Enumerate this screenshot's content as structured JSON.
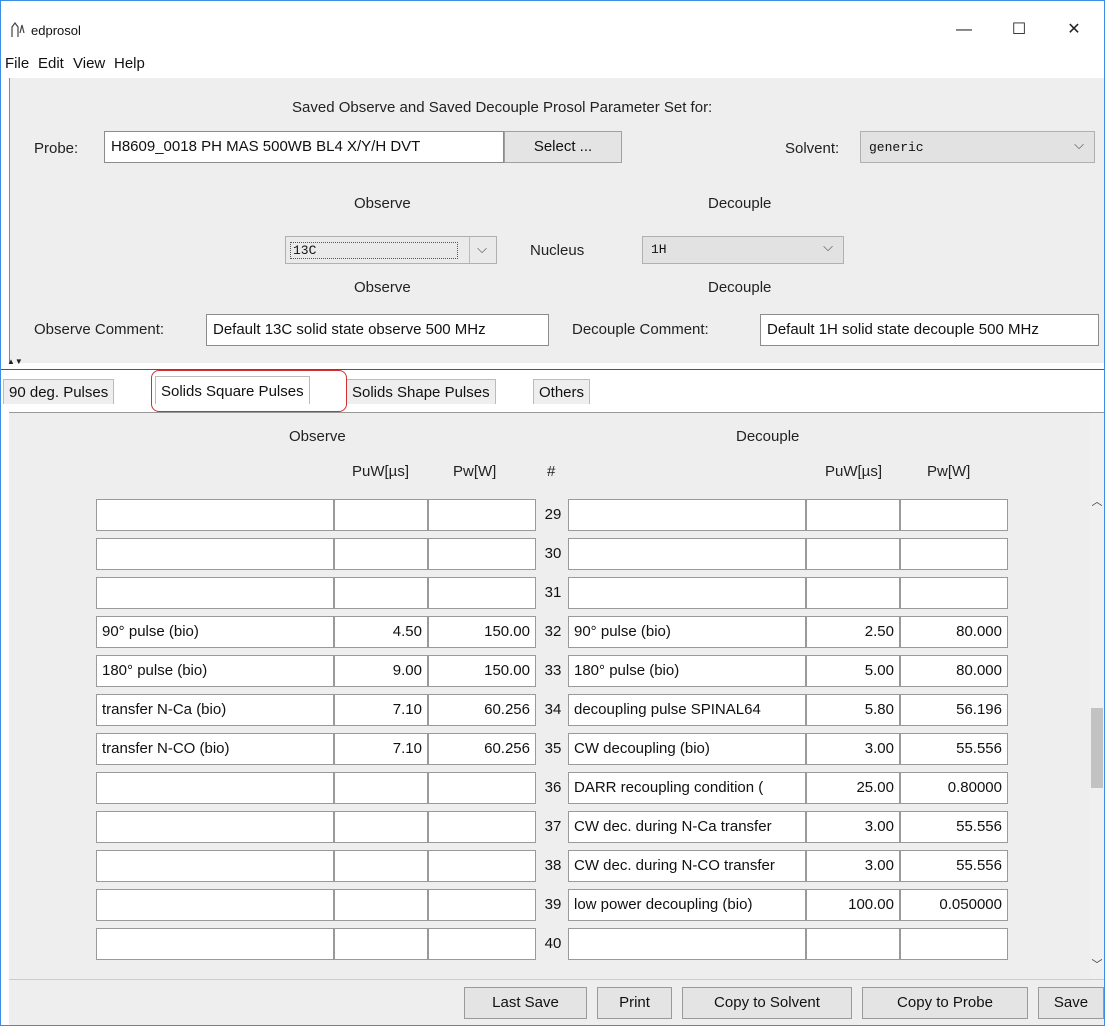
{
  "window": {
    "title": "edprosol",
    "minimize": "—",
    "maximize": "☐",
    "close": "✕"
  },
  "menu": [
    "File",
    "Edit",
    "View",
    "Help"
  ],
  "top": {
    "heading": "Saved Observe and Saved Decouple Prosol Parameter Set for:",
    "probe_label": "Probe:",
    "probe_value": "H8609_0018  PH MAS 500WB BL4 X/Y/H DVT",
    "select_button": "Select ...",
    "solvent_label": "Solvent:",
    "solvent_value": "generic",
    "observe_header": "Observe",
    "decouple_header": "Decouple",
    "nucleus_label": "Nucleus",
    "observe_nucleus": "13C",
    "decouple_nucleus": "1H",
    "observe_sub": "Observe",
    "decouple_sub": "Decouple",
    "observe_comment_label": "Observe Comment:",
    "observe_comment": "Default 13C solid state observe 500 MHz",
    "decouple_comment_label": "Decouple Comment:",
    "decouple_comment": "Default 1H solid state decouple 500 MHz"
  },
  "tabs": [
    {
      "label": "90 deg. Pulses"
    },
    {
      "label": "Solids  Square Pulses"
    },
    {
      "label": "Solids  Shape Pulses"
    },
    {
      "label": "Others"
    }
  ],
  "active_tab": 1,
  "table": {
    "observe_title": "Observe",
    "decouple_title": "Decouple",
    "col_puw": "PuW[µs]",
    "col_pw": "Pw[W]",
    "col_num": "#",
    "col_puw2": "PuW[µs]",
    "col_pw2": "Pw[W]",
    "rows": [
      {
        "num": "29",
        "obs_name": "",
        "obs_puw": "",
        "obs_pw": "",
        "dec_name": "",
        "dec_puw": "",
        "dec_pw": ""
      },
      {
        "num": "30",
        "obs_name": "",
        "obs_puw": "",
        "obs_pw": "",
        "dec_name": "",
        "dec_puw": "",
        "dec_pw": ""
      },
      {
        "num": "31",
        "obs_name": "",
        "obs_puw": "",
        "obs_pw": "",
        "dec_name": "",
        "dec_puw": "",
        "dec_pw": ""
      },
      {
        "num": "32",
        "obs_name": "90° pulse (bio)",
        "obs_puw": "4.50",
        "obs_pw": "150.00",
        "dec_name": "90° pulse (bio)",
        "dec_puw": "2.50",
        "dec_pw": "80.000"
      },
      {
        "num": "33",
        "obs_name": "180° pulse (bio)",
        "obs_puw": "9.00",
        "obs_pw": "150.00",
        "dec_name": "180° pulse (bio)",
        "dec_puw": "5.00",
        "dec_pw": "80.000"
      },
      {
        "num": "34",
        "obs_name": "transfer N-Ca (bio)",
        "obs_puw": "7.10",
        "obs_pw": "60.256",
        "dec_name": "decoupling pulse SPINAL64",
        "dec_puw": "5.80",
        "dec_pw": "56.196"
      },
      {
        "num": "35",
        "obs_name": "transfer N-CO (bio)",
        "obs_puw": "7.10",
        "obs_pw": "60.256",
        "dec_name": "CW decoupling (bio)",
        "dec_puw": "3.00",
        "dec_pw": "55.556"
      },
      {
        "num": "36",
        "obs_name": "",
        "obs_puw": "",
        "obs_pw": "",
        "dec_name": "DARR recoupling condition (",
        "dec_puw": "25.00",
        "dec_pw": "0.80000"
      },
      {
        "num": "37",
        "obs_name": "",
        "obs_puw": "",
        "obs_pw": "",
        "dec_name": "CW dec. during N-Ca transfer",
        "dec_puw": "3.00",
        "dec_pw": "55.556"
      },
      {
        "num": "38",
        "obs_name": "",
        "obs_puw": "",
        "obs_pw": "",
        "dec_name": "CW dec. during N-CO transfer",
        "dec_puw": "3.00",
        "dec_pw": "55.556"
      },
      {
        "num": "39",
        "obs_name": "",
        "obs_puw": "",
        "obs_pw": "",
        "dec_name": "low power decoupling (bio)",
        "dec_puw": "100.00",
        "dec_pw": "0.050000"
      },
      {
        "num": "40",
        "obs_name": "",
        "obs_puw": "",
        "obs_pw": "",
        "dec_name": "",
        "dec_puw": "",
        "dec_pw": ""
      }
    ]
  },
  "buttons": {
    "last_save": "Last Save",
    "print": "Print",
    "copy_solvent": "Copy to Solvent",
    "copy_probe": "Copy to Probe",
    "save": "Save"
  }
}
